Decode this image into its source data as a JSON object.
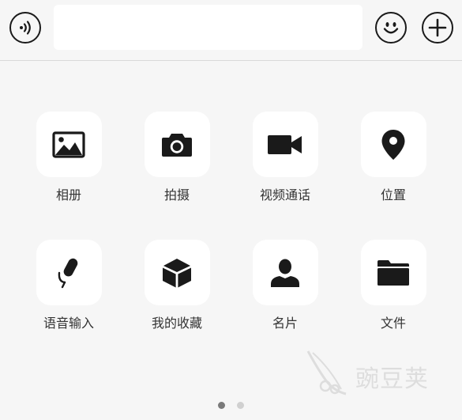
{
  "input_bar": {
    "message_value": ""
  },
  "panel": {
    "row1": [
      {
        "label": "相册",
        "icon": "photo-album-icon"
      },
      {
        "label": "拍摄",
        "icon": "camera-icon"
      },
      {
        "label": "视频通话",
        "icon": "video-call-icon"
      },
      {
        "label": "位置",
        "icon": "location-pin-icon"
      }
    ],
    "row2": [
      {
        "label": "语音输入",
        "icon": "microphone-icon"
      },
      {
        "label": "我的收藏",
        "icon": "favorites-cube-icon"
      },
      {
        "label": "名片",
        "icon": "contact-card-icon"
      },
      {
        "label": "文件",
        "icon": "folder-icon"
      }
    ]
  },
  "pagination": {
    "pages": 2,
    "current": 1
  },
  "watermark": {
    "text": "豌豆荚"
  },
  "colors": {
    "background": "#f6f6f6",
    "tile": "#ffffff",
    "icon": "#1a1a1a",
    "label": "#333333",
    "dot_active": "#7a7a7a",
    "dot_inactive": "#d0d0d0"
  }
}
